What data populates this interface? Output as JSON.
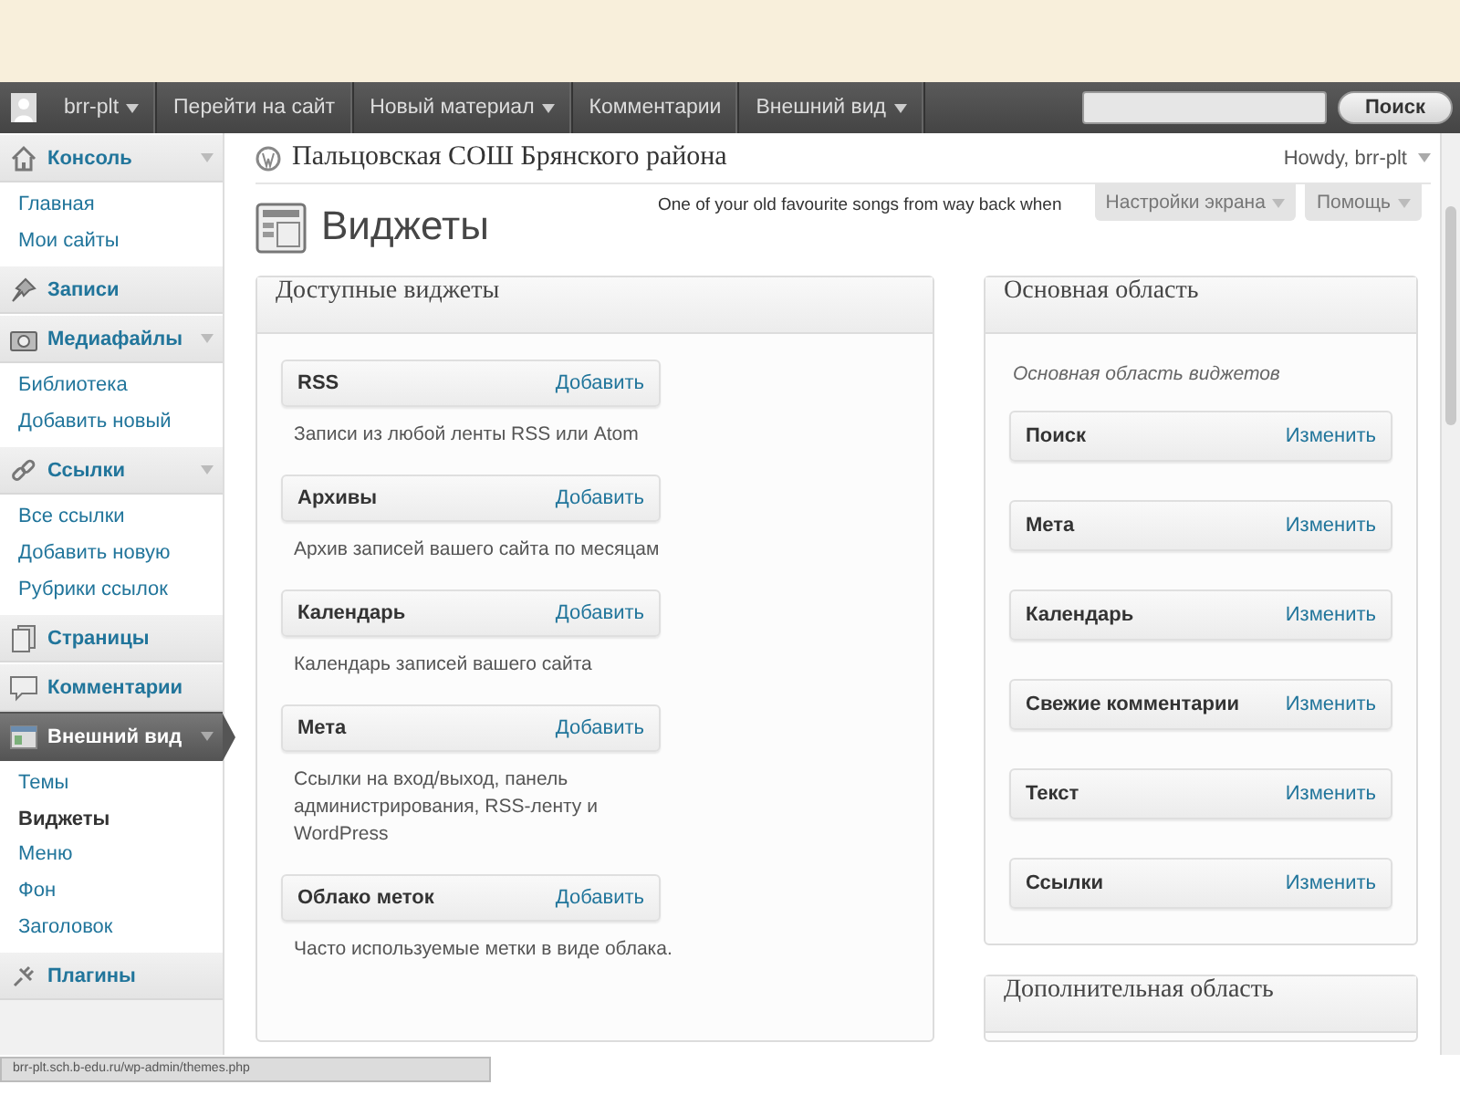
{
  "admin_bar": {
    "user": "brr-plt",
    "user_dropdown": true,
    "items": [
      {
        "label": "Перейти на сайт",
        "dropdown": false
      },
      {
        "label": "Новый материал",
        "dropdown": true
      },
      {
        "label": "Комментарии",
        "dropdown": false
      },
      {
        "label": "Внешний вид",
        "dropdown": true
      }
    ],
    "search_button": "Поиск"
  },
  "sidebar": {
    "sections": [
      {
        "label": "Консоль",
        "toggle": true,
        "selected": false,
        "children": [
          {
            "label": "Главная",
            "selected": false
          },
          {
            "label": "Мои сайты",
            "selected": false
          }
        ]
      },
      {
        "label": "Записи",
        "toggle": false,
        "selected": false
      },
      {
        "label": "Медиафайлы",
        "toggle": true,
        "selected": false,
        "children": [
          {
            "label": "Библиотека",
            "selected": false
          },
          {
            "label": "Добавить новый",
            "selected": false
          }
        ]
      },
      {
        "label": "Ссылки",
        "toggle": true,
        "selected": false,
        "children": [
          {
            "label": "Все ссылки",
            "selected": false
          },
          {
            "label": "Добавить новую",
            "selected": false
          },
          {
            "label": "Рубрики ссылок",
            "selected": false
          }
        ]
      },
      {
        "label": "Страницы",
        "toggle": false,
        "selected": false
      },
      {
        "label": "Комментарии",
        "toggle": false,
        "selected": false
      },
      {
        "label": "Внешний вид",
        "toggle": true,
        "selected": true,
        "children": [
          {
            "label": "Темы",
            "selected": false
          },
          {
            "label": "Виджеты",
            "selected": true
          },
          {
            "label": "Меню",
            "selected": false
          },
          {
            "label": "Фон",
            "selected": false
          },
          {
            "label": "Заголовок",
            "selected": false
          }
        ]
      },
      {
        "label": "Плагины",
        "toggle": false,
        "selected": false
      }
    ]
  },
  "header": {
    "site_title": "Пальцовская СОШ Брянского района",
    "howdy": "Howdy, brr-plt",
    "page_title": "Виджеты",
    "tagline": "One of your old favourite songs from way back when",
    "screen_options": "Настройки экрана",
    "help": "Помощь"
  },
  "available_widgets": {
    "title": "Доступные виджеты",
    "widgets": [
      {
        "name": "RSS",
        "action": "Добавить",
        "description": "Записи из любой ленты RSS или Atom"
      },
      {
        "name": "Архивы",
        "action": "Добавить",
        "description": "Архив записей вашего сайта по месяцам"
      },
      {
        "name": "Календарь",
        "action": "Добавить",
        "description": "Календарь записей вашего сайта"
      },
      {
        "name": "Мета",
        "action": "Добавить",
        "description": "Ссылки на вход/выход, панель администрирования, RSS-ленту и WordPress"
      },
      {
        "name": "Облако меток",
        "action": "Добавить",
        "description": "Часто используемые метки в виде облака."
      }
    ]
  },
  "main_area": {
    "title": "Основная область",
    "description": "Основная область виджетов",
    "widgets": [
      {
        "name": "Поиск",
        "action": "Изменить"
      },
      {
        "name": "Мета",
        "action": "Изменить"
      },
      {
        "name": "Календарь",
        "action": "Изменить"
      },
      {
        "name": "Свежие комментарии",
        "action": "Изменить"
      },
      {
        "name": "Текст",
        "action": "Изменить"
      },
      {
        "name": "Ссылки",
        "action": "Изменить"
      }
    ]
  },
  "secondary_area": {
    "title": "Дополнительная область"
  },
  "status_bar": {
    "url": "brr-plt.sch.b-edu.ru/wp-admin/themes.php"
  }
}
